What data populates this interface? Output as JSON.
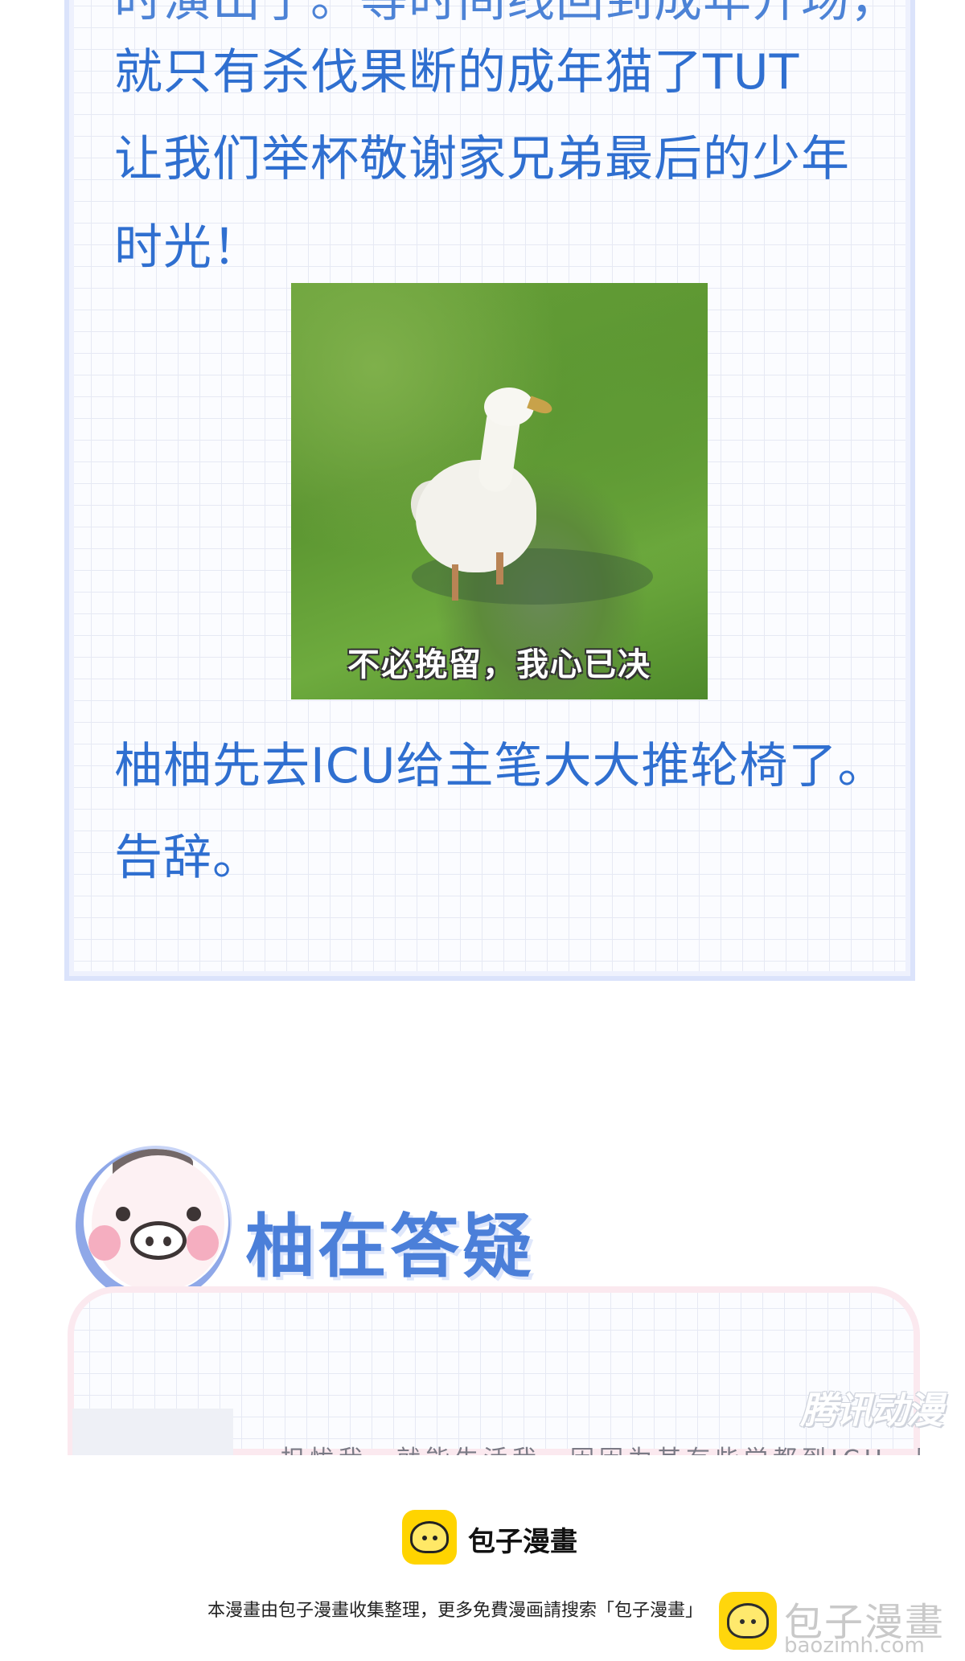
{
  "article": {
    "line0": "时演出了。等时间线回到成年开场，",
    "line1": "就只有杀伐果断的成年猫了TUT",
    "line2": "让我们举杯敬谢家兄弟最后的少年",
    "line3": "时光！",
    "line4": "柚柚先去ICU给主笔大大推轮椅了。",
    "line5": "告辞。"
  },
  "meme": {
    "caption": "不必挽留，我心已决"
  },
  "qa_section": {
    "title": "柚在答疑",
    "preview_text": "担忧我，就能生活我，因因为其有些觉都到ICU，医护人"
  },
  "watermarks": {
    "tencent": "腾讯动漫",
    "baozi_name": "包子漫畫",
    "baozi_url": "baozimh.com"
  },
  "footer": {
    "brand": "包子漫畫",
    "notice": "本漫畫由包子漫畫收集整理，更多免費漫画請搜索「包子漫畫」"
  }
}
